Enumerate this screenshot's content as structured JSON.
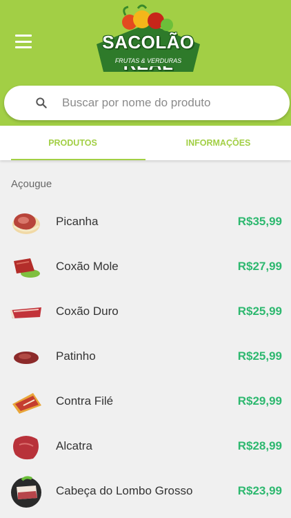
{
  "header": {
    "logo_title": "SACOLÃO REAL",
    "logo_subtitle": "FRUTAS & VERDURAS",
    "menu_icon": "hamburger-menu-icon",
    "background_color": "#a2cf45"
  },
  "search": {
    "placeholder": "Buscar por nome do produto",
    "icon": "search-icon"
  },
  "tabs": [
    {
      "label": "PRODUTOS",
      "active": true
    },
    {
      "label": "INFORMAÇÕES",
      "active": false
    }
  ],
  "section": {
    "title": "Açougue"
  },
  "products": [
    {
      "name": "Picanha",
      "price": "R$35,99"
    },
    {
      "name": "Coxão Mole",
      "price": "R$27,99"
    },
    {
      "name": "Coxão Duro",
      "price": "R$25,99"
    },
    {
      "name": "Patinho",
      "price": "R$25,99"
    },
    {
      "name": "Contra Filé",
      "price": "R$29,99"
    },
    {
      "name": "Alcatra",
      "price": "R$28,99"
    },
    {
      "name": "Cabeça do Lombo Grosso",
      "price": "R$23,99"
    }
  ],
  "colors": {
    "accent": "#a2cf45",
    "price": "#2db86f"
  }
}
